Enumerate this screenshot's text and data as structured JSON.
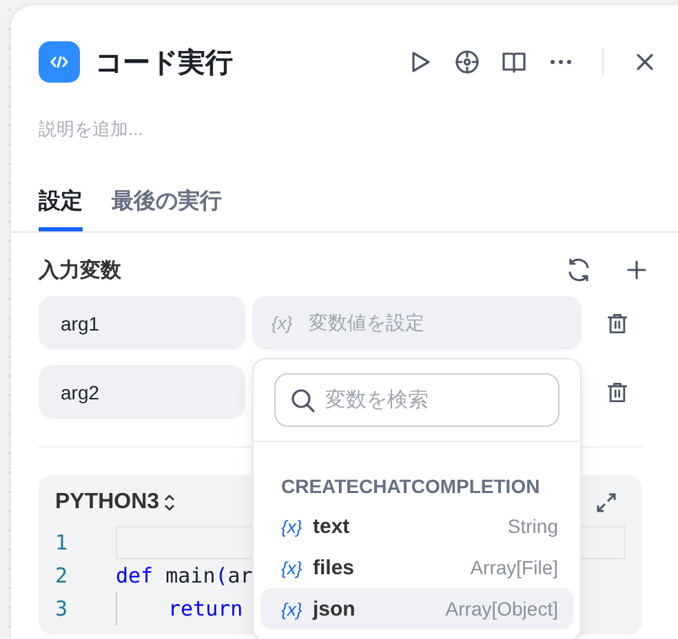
{
  "node": {
    "title": "コード実行",
    "description_placeholder": "説明を追加..."
  },
  "tabs": [
    {
      "label": "設定",
      "selected": true
    },
    {
      "label": "最後の実行",
      "selected": false
    }
  ],
  "input_variables": {
    "label": "入力変数",
    "rows": [
      {
        "name": "arg1",
        "value_placeholder": "変数値を設定",
        "value_icon": "{x}"
      },
      {
        "name": "arg2"
      }
    ]
  },
  "code_editor": {
    "language": "PYTHON3",
    "lines": [
      {
        "number": "1"
      },
      {
        "number": "2",
        "tokens": [
          {
            "kind": "keyword",
            "text": "def"
          },
          {
            "kind": "plain",
            "text": " main"
          },
          {
            "kind": "punct",
            "text": "("
          },
          {
            "kind": "plain",
            "text": "ar"
          }
        ],
        "children": [
          {
            "number": "3",
            "tokens": [
              {
                "kind": "keyword",
                "text": "return"
              }
            ]
          }
        ]
      }
    ]
  },
  "variable_picker": {
    "search_placeholder": "変数を検索",
    "group": "CREATECHATCOMPLETION",
    "items": [
      {
        "icon": "{x}",
        "name": "text",
        "type": "String",
        "selected": false
      },
      {
        "icon": "{x}",
        "name": "files",
        "type": "Array[File]",
        "selected": false
      },
      {
        "icon": "{x}",
        "name": "json",
        "type": "Array[Object]",
        "selected": true
      }
    ]
  }
}
